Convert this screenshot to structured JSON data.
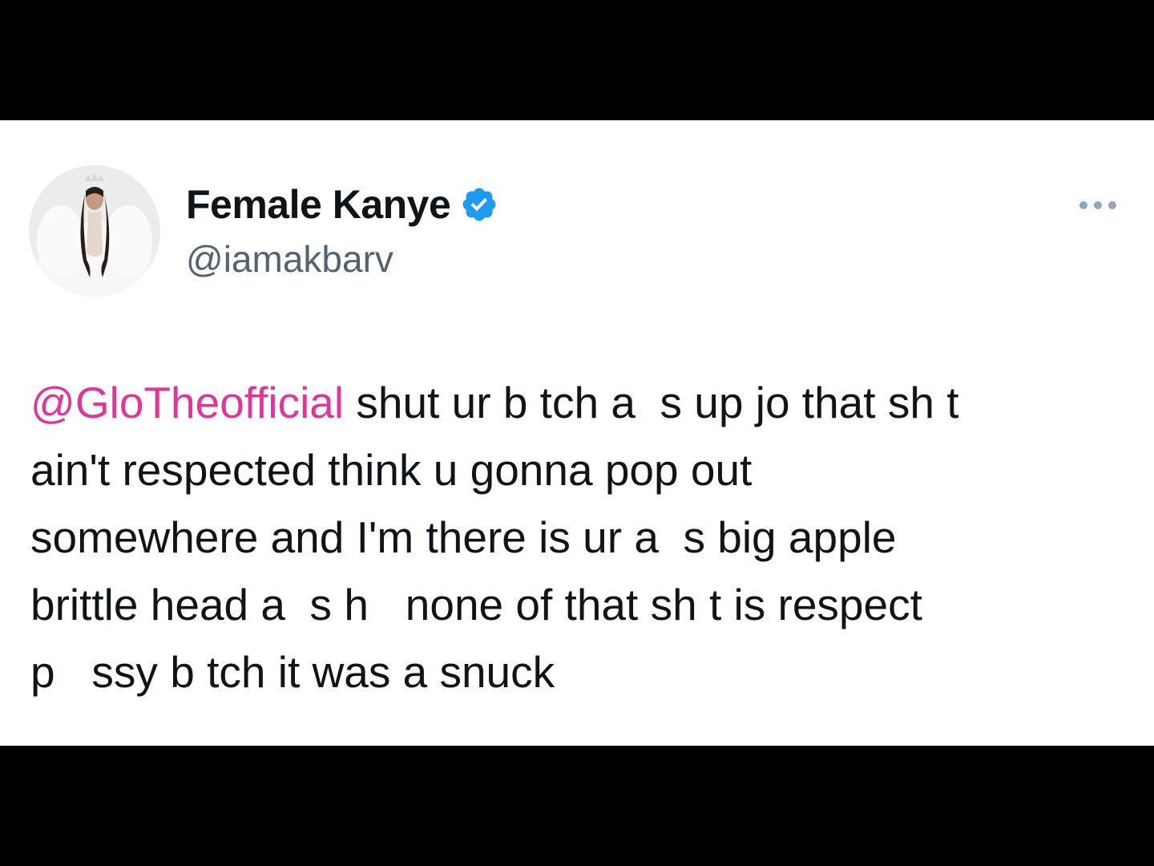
{
  "tweet": {
    "author": {
      "name": "Female Kanye",
      "handle": "@iamakbarv",
      "verified": true
    },
    "more_icon": "more-horizontal-icon",
    "mention": "@GloTheofficial",
    "lines": [
      " shut ur b tch a  s up jo that sh t",
      "ain't respected think u gonna pop out",
      "somewhere and I'm there is ur a  s big apple",
      "brittle head a  s h   none of that sh t is respect",
      "p   ssy b tch it was a snuck"
    ]
  },
  "colors": {
    "background_bars": "#000000",
    "card": "#ffffff",
    "text": "#0f1419",
    "handle": "#536471",
    "mention": "#e0369a",
    "verified": "#1d9bf0"
  }
}
